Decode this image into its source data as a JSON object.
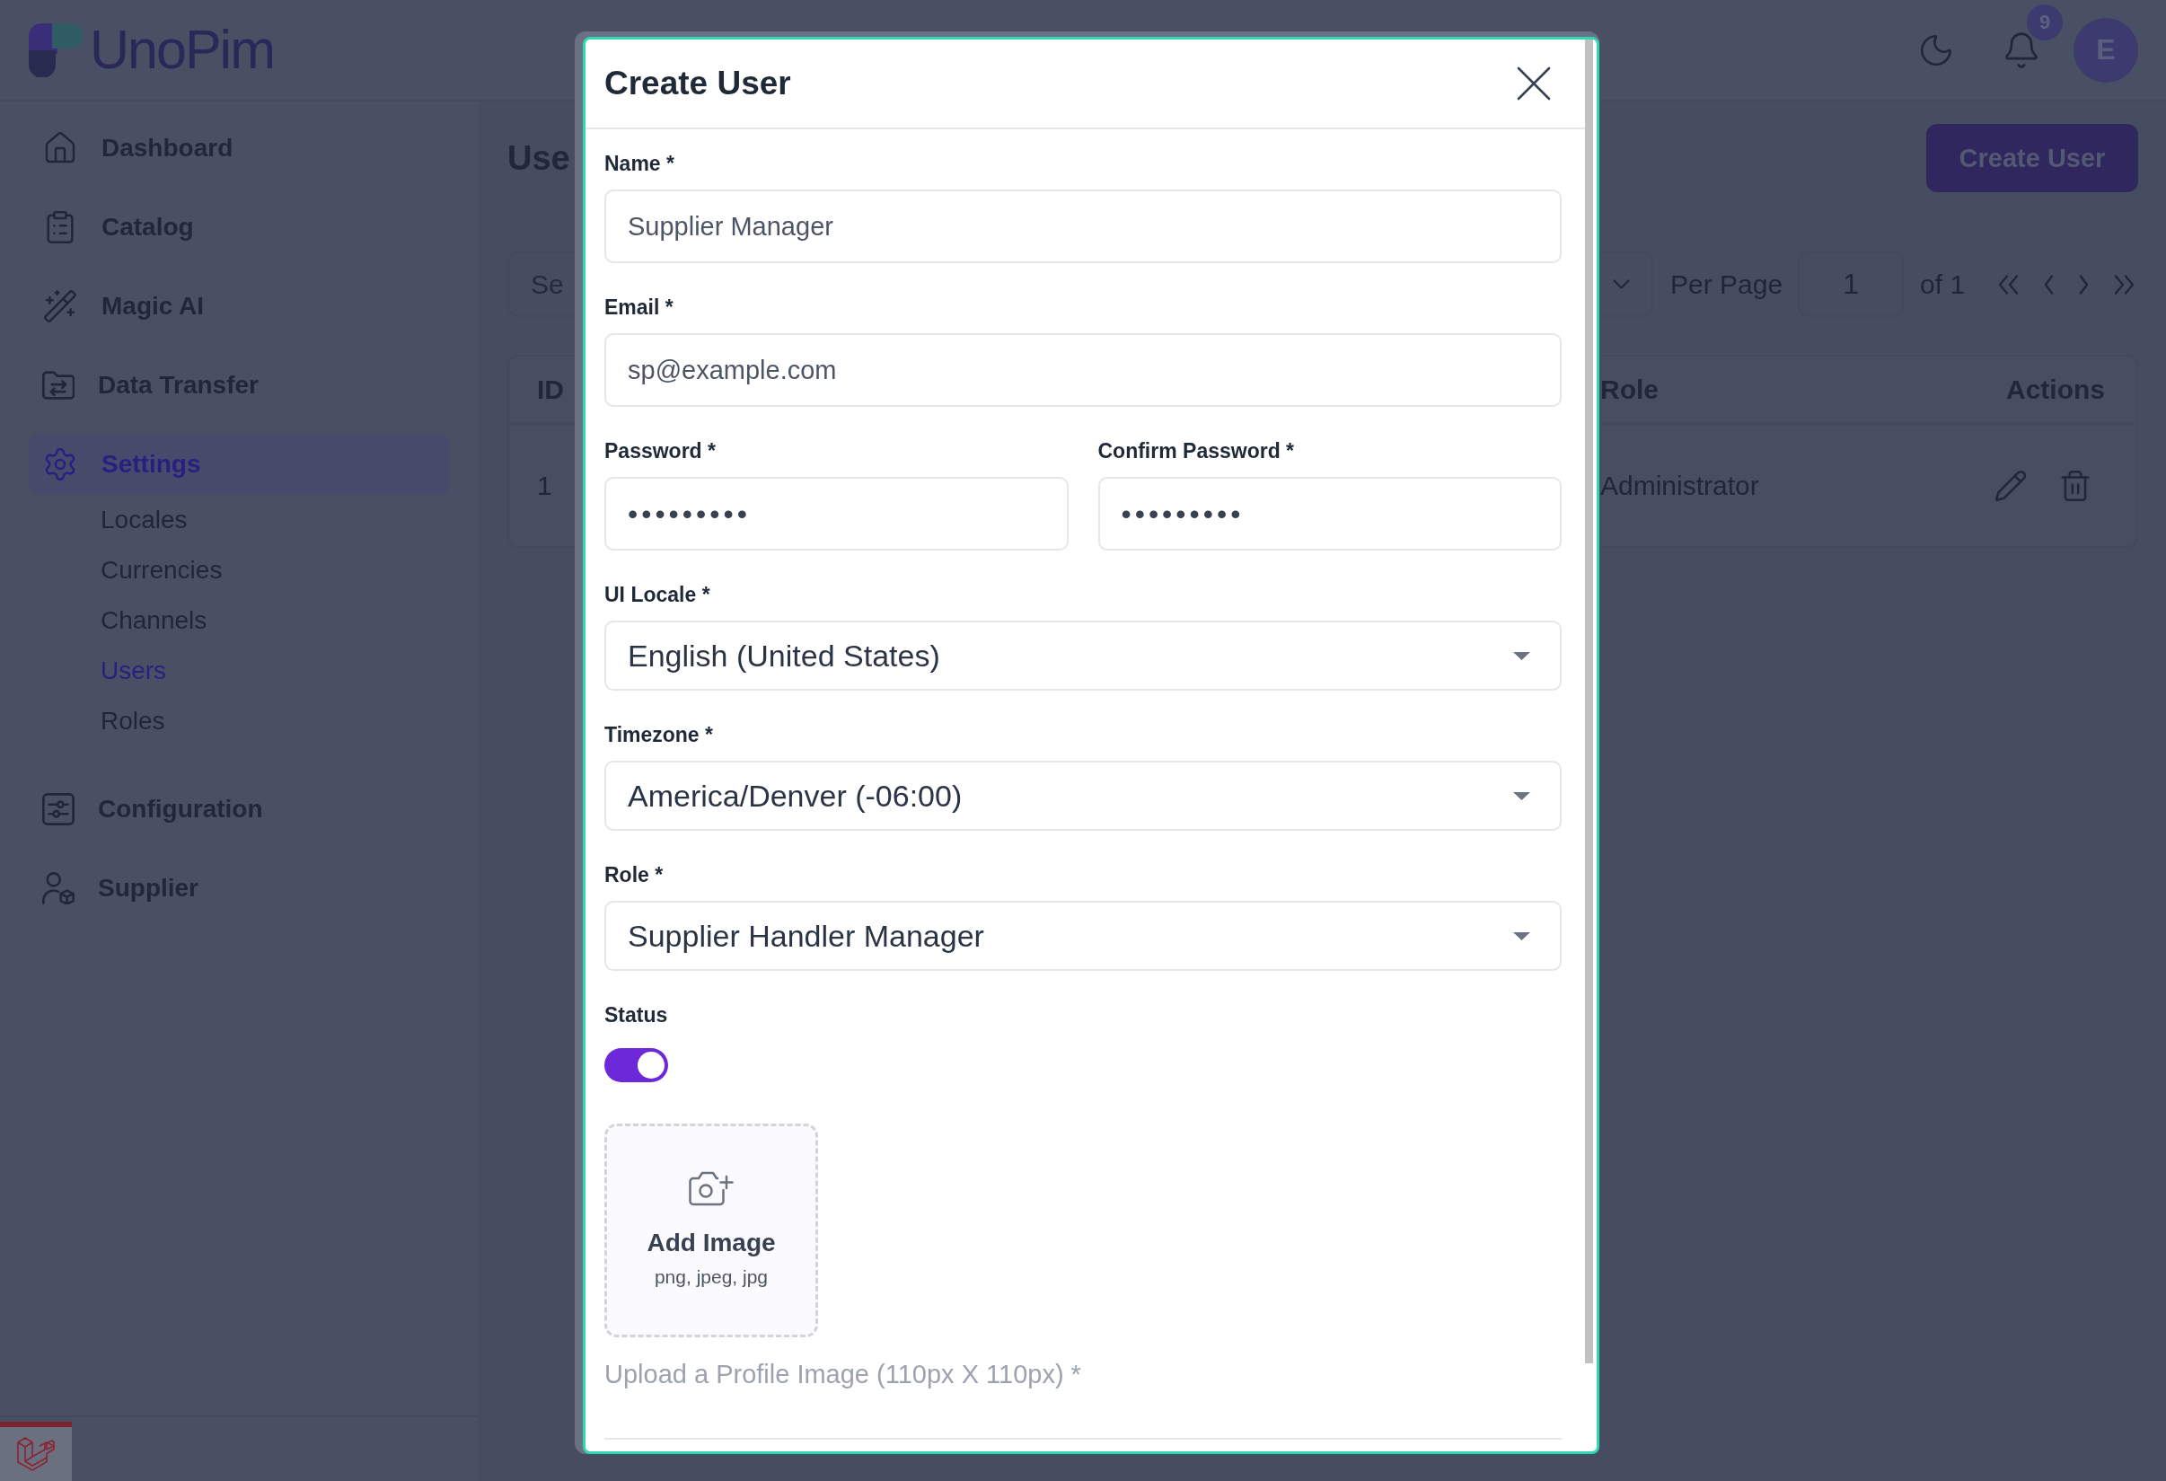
{
  "header": {
    "logo_text": "UnoPim",
    "notification_count": "9",
    "avatar_initial": "E"
  },
  "sidebar": {
    "items": [
      {
        "label": "Dashboard",
        "selected": false
      },
      {
        "label": "Catalog",
        "selected": false
      },
      {
        "label": "Magic AI",
        "selected": false
      },
      {
        "label": "Data Transfer",
        "selected": false
      },
      {
        "label": "Settings",
        "selected": true,
        "children": [
          {
            "label": "Locales",
            "selected": false
          },
          {
            "label": "Currencies",
            "selected": false
          },
          {
            "label": "Channels",
            "selected": false
          },
          {
            "label": "Users",
            "selected": true
          },
          {
            "label": "Roles",
            "selected": false
          }
        ]
      },
      {
        "label": "Configuration",
        "selected": false
      },
      {
        "label": "Supplier",
        "selected": false
      }
    ]
  },
  "page": {
    "title": "Use",
    "create_button": "Create User",
    "search": {
      "placeholder": "Se"
    },
    "pagination": {
      "per_page_label": "Per Page",
      "page": "1",
      "total": "of 1"
    },
    "table": {
      "columns": [
        "ID",
        "Role",
        "Actions"
      ],
      "rows": [
        {
          "id": "1",
          "role": "Administrator"
        }
      ]
    }
  },
  "modal": {
    "title": "Create User",
    "rows": [
      {
        "fields": [
          {
            "kind": "text",
            "label": "Name *",
            "value": "Supplier Manager"
          }
        ]
      },
      {
        "fields": [
          {
            "kind": "text",
            "label": "Email *",
            "value": "sp@example.com"
          }
        ]
      },
      {
        "fields": [
          {
            "kind": "password",
            "label": "Password *",
            "value": "•••••••••"
          },
          {
            "kind": "password",
            "label": "Confirm Password *",
            "value": "•••••••••"
          }
        ]
      },
      {
        "fields": [
          {
            "kind": "select",
            "label": "UI Locale *",
            "value": "English (United States)"
          }
        ]
      },
      {
        "fields": [
          {
            "kind": "select",
            "label": "Timezone *",
            "value": "America/Denver (-06:00)"
          }
        ]
      },
      {
        "fields": [
          {
            "kind": "select",
            "label": "Role *",
            "value": "Supplier Handler Manager"
          }
        ]
      }
    ],
    "status": {
      "label": "Status",
      "on": true
    },
    "image_upload": {
      "title": "Add Image",
      "formats": "png, jpeg, jpg",
      "hint": "Upload a Profile Image (110px X 110px) *"
    }
  }
}
